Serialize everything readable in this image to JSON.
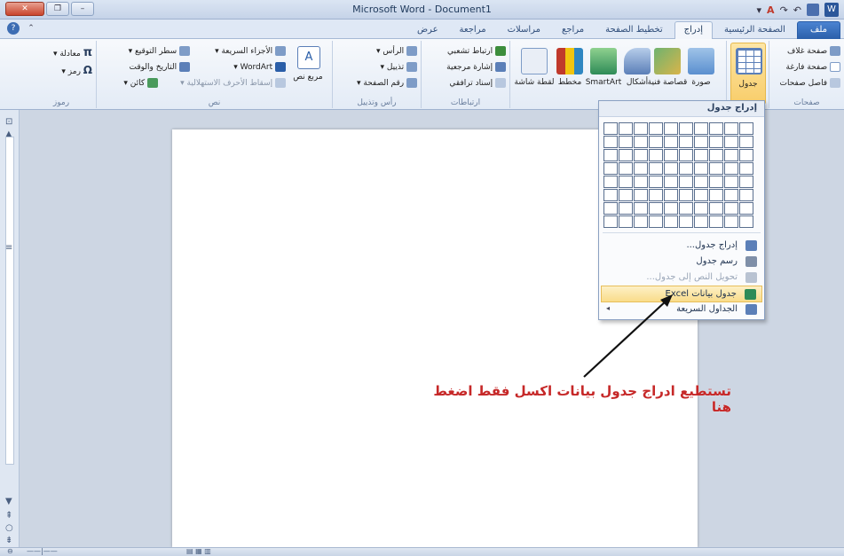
{
  "window": {
    "title": "Microsoft Word - Document1"
  },
  "tabs": [
    {
      "label": "ملف",
      "kind": "file"
    },
    {
      "label": "الصفحة الرئيسية"
    },
    {
      "label": "إدراج",
      "active": true
    },
    {
      "label": "تخطيط الصفحة"
    },
    {
      "label": "مراجع"
    },
    {
      "label": "مراسلات"
    },
    {
      "label": "مراجعة"
    },
    {
      "label": "عرض"
    }
  ],
  "ribbon": {
    "pages": {
      "label": "صفحات",
      "cover": "صفحة غلاف",
      "blank": "صفحة فارغة",
      "break": "فاصل صفحات"
    },
    "tables": {
      "table_button": "جدول"
    },
    "illustrations": {
      "picture": "صورة",
      "clipart": "قصاصة فنية",
      "shapes": "أشكال",
      "smartart": "SmartArt",
      "chart": "مخطط",
      "screenshot": "لقطة شاشة"
    },
    "links": {
      "label": "ارتباطات",
      "hyperlink": "ارتباط تشعبي",
      "bookmark": "إشارة مرجعية",
      "crossref": "إسناد ترافقي"
    },
    "header_footer": {
      "label": "رأس وتذييل",
      "header": "الرأس",
      "footer": "تذييل",
      "page_number": "رقم الصفحة"
    },
    "text": {
      "label": "نص",
      "textbox": "مربع نص",
      "quickparts": "الأجزاء السريعة",
      "wordart": "WordArt",
      "dropcap": "إسقاط الأحرف الاستهلالية",
      "signature": "سطر التوقيع",
      "datetime": "التاريخ والوقت",
      "object": "كائن"
    },
    "symbols": {
      "label": "رموز",
      "equation": "معادلة",
      "symbol": "رمز"
    }
  },
  "table_menu": {
    "header": "إدراج جدول",
    "rows": 8,
    "cols": 10,
    "items": [
      {
        "label": "إدراج جدول...",
        "state": "normal",
        "icon_color": "#5b7fb8"
      },
      {
        "label": "رسم جدول",
        "state": "normal",
        "icon_color": "#7f8fa8"
      },
      {
        "label": "تحويل النص إلى جدول...",
        "state": "disabled",
        "icon_color": "#b9c3d2"
      },
      {
        "label": "جدول بيانات Excel",
        "state": "hover",
        "icon_color": "#2e8b57"
      },
      {
        "label": "الجداول السريعة",
        "state": "normal",
        "icon_color": "#5b7fb8",
        "submenu": true
      }
    ]
  },
  "annotation": {
    "text": "تستطيع ادراج جدول بيانات اكسل فقط اضغط هنا",
    "color": "#c62828"
  },
  "colors": {
    "accent": "#2a5ea8",
    "highlight": "#f9dc8a"
  }
}
